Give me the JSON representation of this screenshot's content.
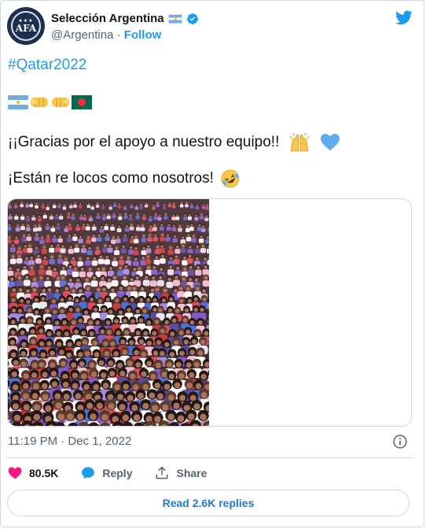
{
  "account": {
    "display_name": "Selección Argentina",
    "handle": "@Argentina",
    "separator": "·",
    "follow_label": "Follow",
    "avatar_text": "AFA",
    "avatar_stars": "★★★"
  },
  "tweet": {
    "hashtag": "#Qatar2022",
    "emoji_line": [
      "flag-argentina",
      "raised-fist-medium-light",
      "raised-fist-medium-light",
      "flag-bangladesh"
    ],
    "line1": "¡¡Gracias por el apoyo a nuestro equipo!!",
    "line1_emojis": [
      "raising-hands",
      "blue-heart"
    ],
    "line2": "¡Están re locos como nosotros!",
    "line2_emoji": "rolling-on-floor-laughing",
    "media_description": "crowd-photo",
    "timestamp": "11:19 PM · Dec 1, 2022"
  },
  "actions": {
    "likes": "80.5K",
    "reply_label": "Reply",
    "share_label": "Share",
    "read_replies_label": "Read 2.6K replies"
  },
  "colors": {
    "accent": "#1d9bf0",
    "like": "#f91880",
    "text": "#0f1419",
    "muted": "#536471",
    "border": "#cfd9de"
  }
}
